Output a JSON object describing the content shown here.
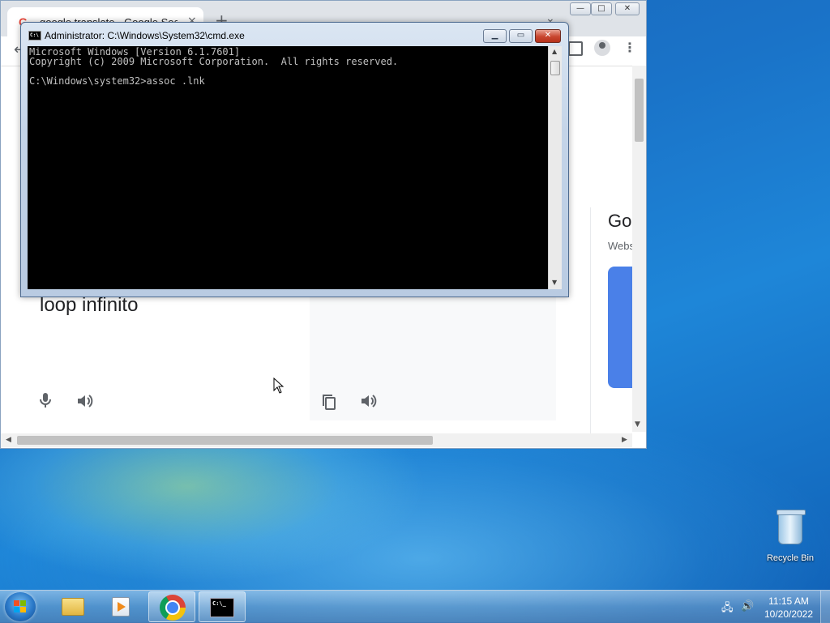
{
  "browser": {
    "tab_icon": "G",
    "tab_title": "google translate - Google Search",
    "tab_close": "×",
    "new_tab": "+",
    "tab_menu": "⌄",
    "window_controls": {
      "minimize": "—",
      "maximize": "□",
      "close": "✕"
    },
    "back": "←",
    "menu": "⋮",
    "source_text": "loop infinito",
    "side_card": {
      "title": "Go",
      "subtitle": "Webs"
    },
    "scroll_arrows": {
      "left": "◀",
      "right": "▶",
      "down": "▼"
    }
  },
  "cmd": {
    "title": "Administrator: C:\\Windows\\System32\\cmd.exe",
    "icon_text": "C:\\",
    "controls": {
      "minimize": "▁",
      "maximize": "▭",
      "close": "✕"
    },
    "lines": [
      "Microsoft Windows [Version 6.1.7601]",
      "Copyright (c) 2009 Microsoft Corporation.  All rights reserved.",
      "",
      "C:\\Windows\\system32>assoc .lnk"
    ],
    "scroll_up": "▲",
    "scroll_down": "▼"
  },
  "desktop": {
    "recycle_bin_label": "Recycle Bin"
  },
  "taskbar": {
    "clock_time": "11:15 AM",
    "clock_date": "10/20/2022",
    "cmd_icon_text": "C:\\_",
    "network_icon": "🖧",
    "volume_icon": "🔊"
  },
  "colors": {
    "console_bg": "#000000",
    "console_fg": "#c0c0c0",
    "desktop_blue": "#1a73c8",
    "translate_card_blue": "#4a80e8"
  }
}
